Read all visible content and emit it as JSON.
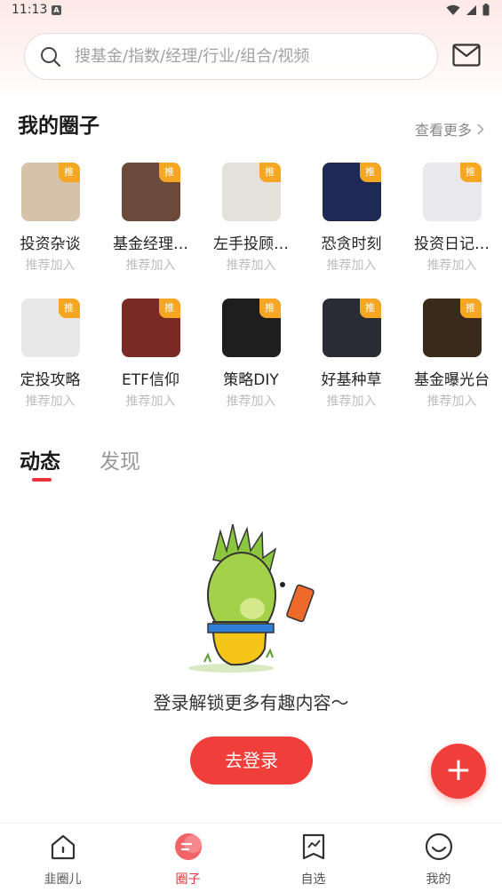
{
  "status_bar": {
    "time": "11:13",
    "notification_letter": "A"
  },
  "search": {
    "placeholder": "搜基金/指数/经理/行业/组合/视频"
  },
  "my_circles": {
    "title": "我的圈子",
    "see_more": "查看更多",
    "badge": "推",
    "items": [
      {
        "name": "投资杂谈",
        "action": "推荐加入",
        "color": "#d6c2a8"
      },
      {
        "name": "基金经理…",
        "action": "推荐加入",
        "color": "#6b4a3a"
      },
      {
        "name": "左手投顾…",
        "action": "推荐加入",
        "color": "#e4e1da"
      },
      {
        "name": "恐贪时刻",
        "action": "推荐加入",
        "color": "#1e2a55"
      },
      {
        "name": "投资日记…",
        "action": "推荐加入",
        "color": "#e9e9ec"
      },
      {
        "name": "定投攻略",
        "action": "推荐加入",
        "color": "#e8e8e8"
      },
      {
        "name": "ETF信仰",
        "action": "推荐加入",
        "color": "#7a2a24"
      },
      {
        "name": "策略DIY",
        "action": "推荐加入",
        "color": "#1e1e1e"
      },
      {
        "name": "好基种草",
        "action": "推荐加入",
        "color": "#2a2c35"
      },
      {
        "name": "基金曝光台",
        "action": "推荐加入",
        "color": "#3a2a1c"
      }
    ]
  },
  "feed_tabs": [
    {
      "label": "动态",
      "active": true
    },
    {
      "label": "发现",
      "active": false
    }
  ],
  "empty_state": {
    "message": "登录解锁更多有趣内容～",
    "button": "去登录"
  },
  "fab": {
    "symbol": "+"
  },
  "bottom_nav": [
    {
      "label": "韭圈儿",
      "icon": "home-icon",
      "active": false
    },
    {
      "label": "圈子",
      "icon": "circle-chat-icon",
      "active": true
    },
    {
      "label": "自选",
      "icon": "watchlist-icon",
      "active": false
    },
    {
      "label": "我的",
      "icon": "profile-smile-icon",
      "active": false
    }
  ],
  "colors": {
    "accent": "#f03e3a",
    "badge": "#f5a623"
  }
}
